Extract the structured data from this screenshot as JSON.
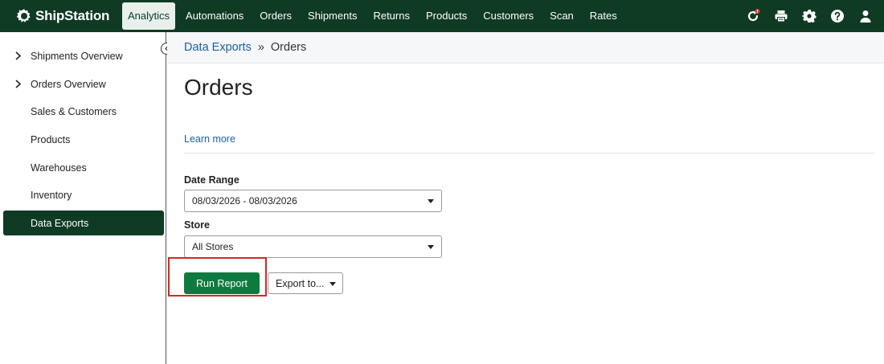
{
  "brand": {
    "name": "ShipStation"
  },
  "nav": {
    "items": [
      {
        "label": "Analytics",
        "active": true
      },
      {
        "label": "Automations"
      },
      {
        "label": "Orders"
      },
      {
        "label": "Shipments"
      },
      {
        "label": "Returns"
      },
      {
        "label": "Products"
      },
      {
        "label": "Customers"
      },
      {
        "label": "Scan"
      },
      {
        "label": "Rates"
      }
    ],
    "icons": [
      "refresh-alert-icon",
      "printer-icon",
      "gear-icon",
      "help-icon",
      "user-icon"
    ]
  },
  "sidebar": {
    "items": [
      {
        "label": "Shipments Overview",
        "expandable": true
      },
      {
        "label": "Orders Overview",
        "expandable": true
      },
      {
        "label": "Sales & Customers"
      },
      {
        "label": "Products"
      },
      {
        "label": "Warehouses"
      },
      {
        "label": "Inventory"
      },
      {
        "label": "Data Exports",
        "active": true
      }
    ]
  },
  "breadcrumb": {
    "parent": "Data Exports",
    "separator": "»",
    "current": "Orders"
  },
  "page": {
    "title": "Orders",
    "learn_more": "Learn more"
  },
  "form": {
    "date_range": {
      "label": "Date Range",
      "value": "08/03/2026 - 08/03/2026"
    },
    "store": {
      "label": "Store",
      "value": "All Stores"
    },
    "run_button": "Run Report",
    "export_button": "Export to..."
  },
  "colors": {
    "topbar": "#0f3a24",
    "accent_green": "#0e7a3f",
    "link": "#1a5fa8",
    "highlight": "#d9252a",
    "alert_badge": "#e8452c"
  }
}
